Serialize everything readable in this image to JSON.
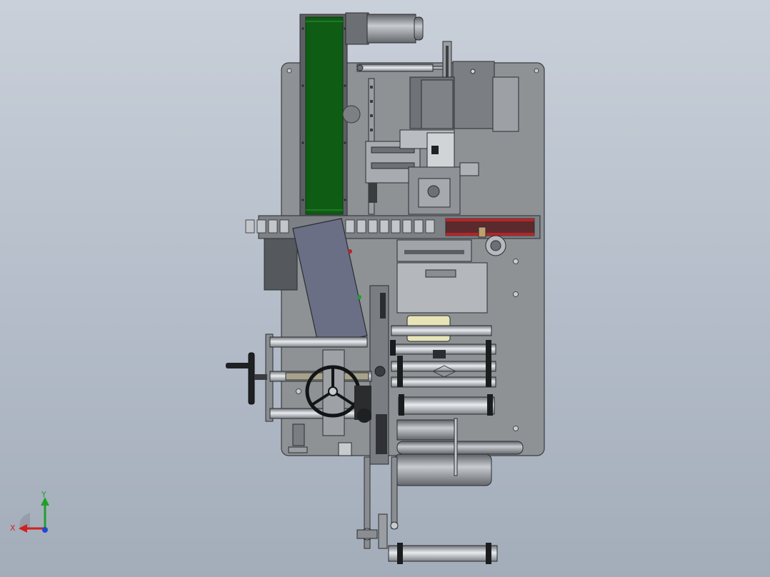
{
  "viewport": {
    "background_top": "#c9d0da",
    "background_bottom": "#a3adb9",
    "view": "Top"
  },
  "triad": {
    "x_label": "X",
    "y_label": "Y",
    "x_color": "#d22020",
    "y_color": "#1fa02a",
    "z_color": "#2048d0"
  },
  "model": {
    "frame_color": "#8e9295",
    "belt_color": "#0f5c14",
    "chain_accent": "#b2262a",
    "label_pad_color": "#e7e4b8"
  }
}
